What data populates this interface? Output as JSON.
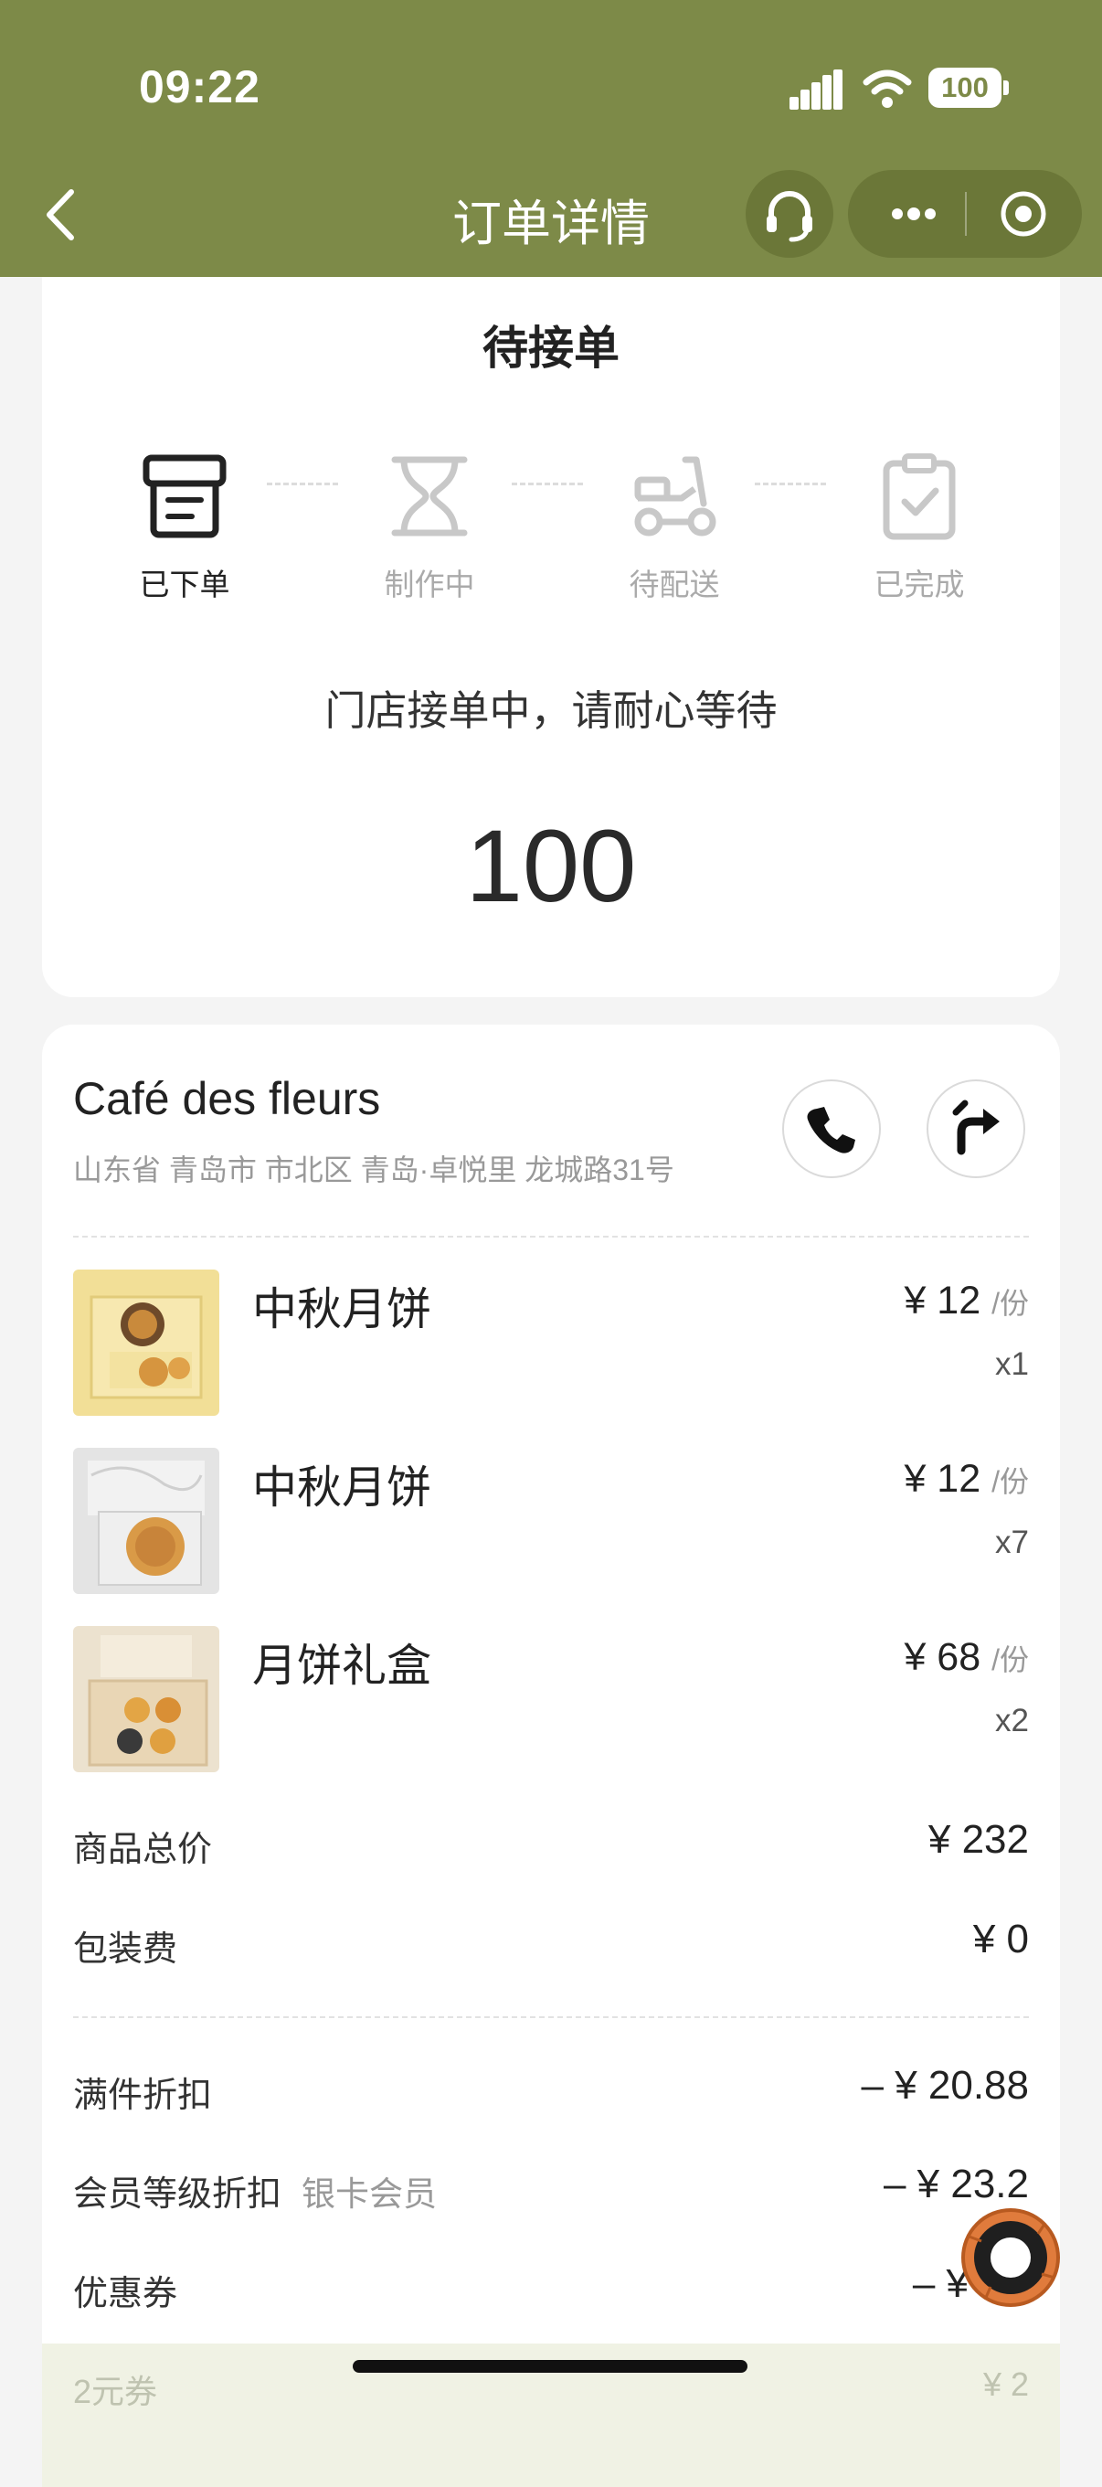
{
  "status_bar": {
    "time": "09:22",
    "battery": "100"
  },
  "nav": {
    "title": "订单详情"
  },
  "order_status": {
    "title": "待接单",
    "steps": [
      {
        "label": "已下单",
        "active": true,
        "icon": "receipt-icon"
      },
      {
        "label": "制作中",
        "active": false,
        "icon": "hourglass-icon"
      },
      {
        "label": "待配送",
        "active": false,
        "icon": "scooter-icon"
      },
      {
        "label": "已完成",
        "active": false,
        "icon": "clipboard-check-icon"
      }
    ],
    "message": "门店接单中，请耐心等待",
    "queue_number": "100"
  },
  "store": {
    "name": "Café des fleurs",
    "address": "山东省 青岛市 市北区 青岛·卓悦里 龙城路31号"
  },
  "items": [
    {
      "name": "中秋月饼",
      "price": "¥ 12",
      "unit": "/份",
      "qty": "x1"
    },
    {
      "name": "中秋月饼",
      "price": "¥ 12",
      "unit": "/份",
      "qty": "x7"
    },
    {
      "name": "月饼礼盒",
      "price": "¥ 68",
      "unit": "/份",
      "qty": "x2"
    }
  ],
  "summary": {
    "subtotal_label": "商品总价",
    "subtotal_value": "¥ 232",
    "packaging_label": "包装费",
    "packaging_value": "¥ 0"
  },
  "discounts": {
    "bulk_label": "满件折扣",
    "bulk_value": "– ¥ 20.88",
    "member_label": "会员等级折扣",
    "member_level": "银卡会员",
    "member_value": "– ¥ 23.2",
    "coupon_label": "优惠券",
    "coupon_value": "– ¥"
  },
  "coupon_strip": {
    "label": "2元券",
    "value": "¥ 2"
  },
  "colors": {
    "header": "#7d8a48",
    "float_button": "#e07b3c"
  }
}
